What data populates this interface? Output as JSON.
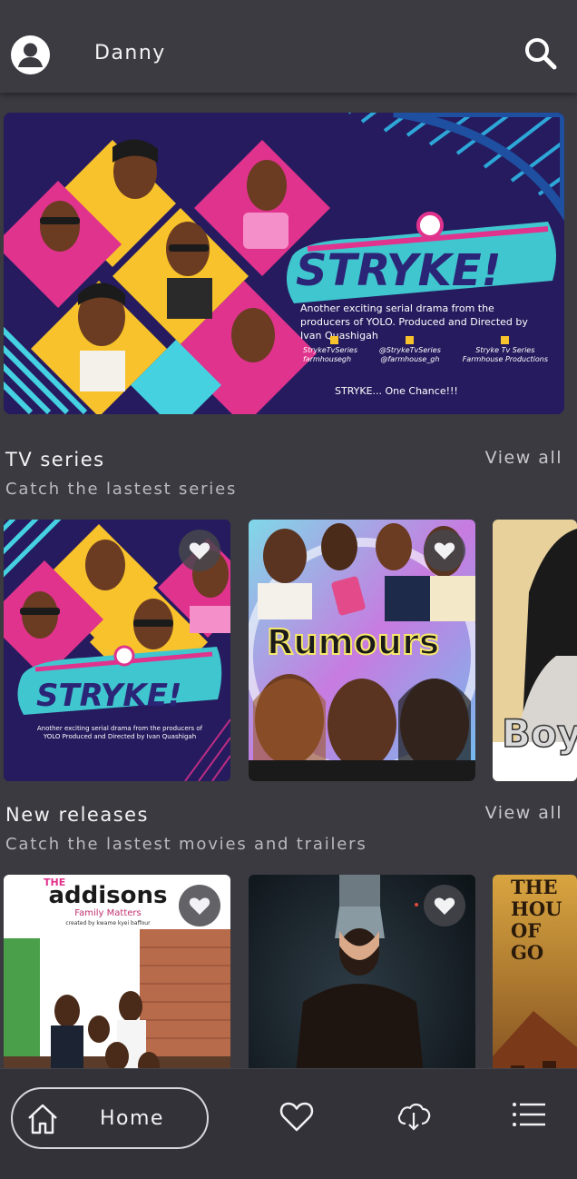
{
  "header": {
    "username": "Danny"
  },
  "banner": {
    "title": "STRYKE!",
    "tagline": "Another exciting serial drama from the producers of YOLO. Produced and Directed by Ivan Quashigah",
    "socials": [
      {
        "icon": "twitter-icon",
        "line1": "StrykeTvSeries",
        "line2": "farmhousegh"
      },
      {
        "icon": "instagram-icon",
        "line1": "@StrykeTvSeries",
        "line2": "@farmhouse_gh"
      },
      {
        "icon": "facebook-icon",
        "line1": "Stryke Tv Series",
        "line2": "Farmhouse Productions"
      }
    ],
    "slogan": "STRYKE... One Chance!!!"
  },
  "sections": [
    {
      "title": "TV series",
      "subtitle": "Catch the lastest series",
      "view_all": "View all",
      "cards": [
        {
          "title": "STRYKE!",
          "caption": "Another exciting serial drama from the producers of YOLO Produced and Directed by Ivan Quashigah"
        },
        {
          "title": "Rumours"
        },
        {
          "title": "Boy"
        }
      ]
    },
    {
      "title": "New releases",
      "subtitle": "Catch the lastest movies and trailers",
      "view_all": "View all",
      "cards": [
        {
          "title_small": "THE",
          "title": "addisons",
          "subtitle": "Family Matters",
          "credit": "created by kwame kyei baffour"
        },
        {
          "title": ""
        },
        {
          "title": "THE HOU OF GO"
        }
      ]
    }
  ],
  "bottom_nav": {
    "home_label": "Home",
    "items": [
      "home-icon",
      "heart-icon",
      "cloud-download-icon",
      "menu-list-icon"
    ]
  },
  "colors": {
    "background": "#3a3a40",
    "topbar": "#3b3b41",
    "bottomnav": "#323238",
    "text": "#f2f2f4"
  }
}
